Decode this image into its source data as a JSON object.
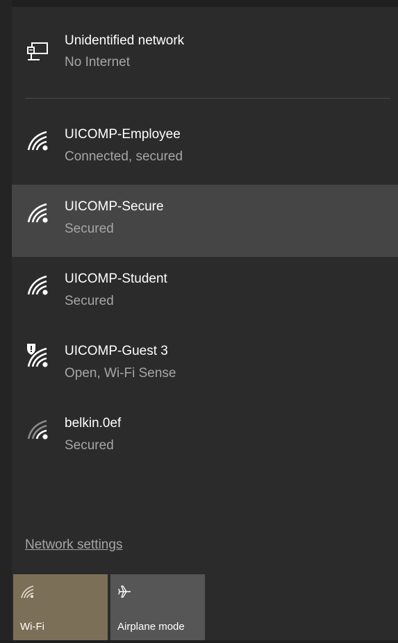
{
  "networks": [
    {
      "name": "Unidentified network",
      "status": "No Internet",
      "icon": "wired-network-icon"
    },
    {
      "name": "UICOMP-Employee",
      "status": "Connected, secured",
      "icon": "wifi-signal-icon"
    },
    {
      "name": "UICOMP-Secure",
      "status": "Secured",
      "icon": "wifi-signal-icon"
    },
    {
      "name": "UICOMP-Student",
      "status": "Secured",
      "icon": "wifi-signal-icon"
    },
    {
      "name": "UICOMP-Guest 3",
      "status": "Open, Wi-Fi Sense",
      "icon": "wifi-open-warning-icon"
    },
    {
      "name": "belkin.0ef",
      "status": "Secured",
      "icon": "wifi-weak-signal-icon"
    }
  ],
  "settings_link": "Network settings",
  "tiles": {
    "wifi": {
      "label": "Wi-Fi",
      "icon": "wifi-tile-icon",
      "active": true,
      "color": "#7c6f58"
    },
    "airplane": {
      "label": "Airplane mode",
      "icon": "airplane-icon",
      "active": false,
      "color": "#565656"
    }
  },
  "colors": {
    "background": "#2b2b2b",
    "hover": "#454545",
    "text_primary": "#ffffff",
    "text_secondary": "#a6a6a6"
  }
}
